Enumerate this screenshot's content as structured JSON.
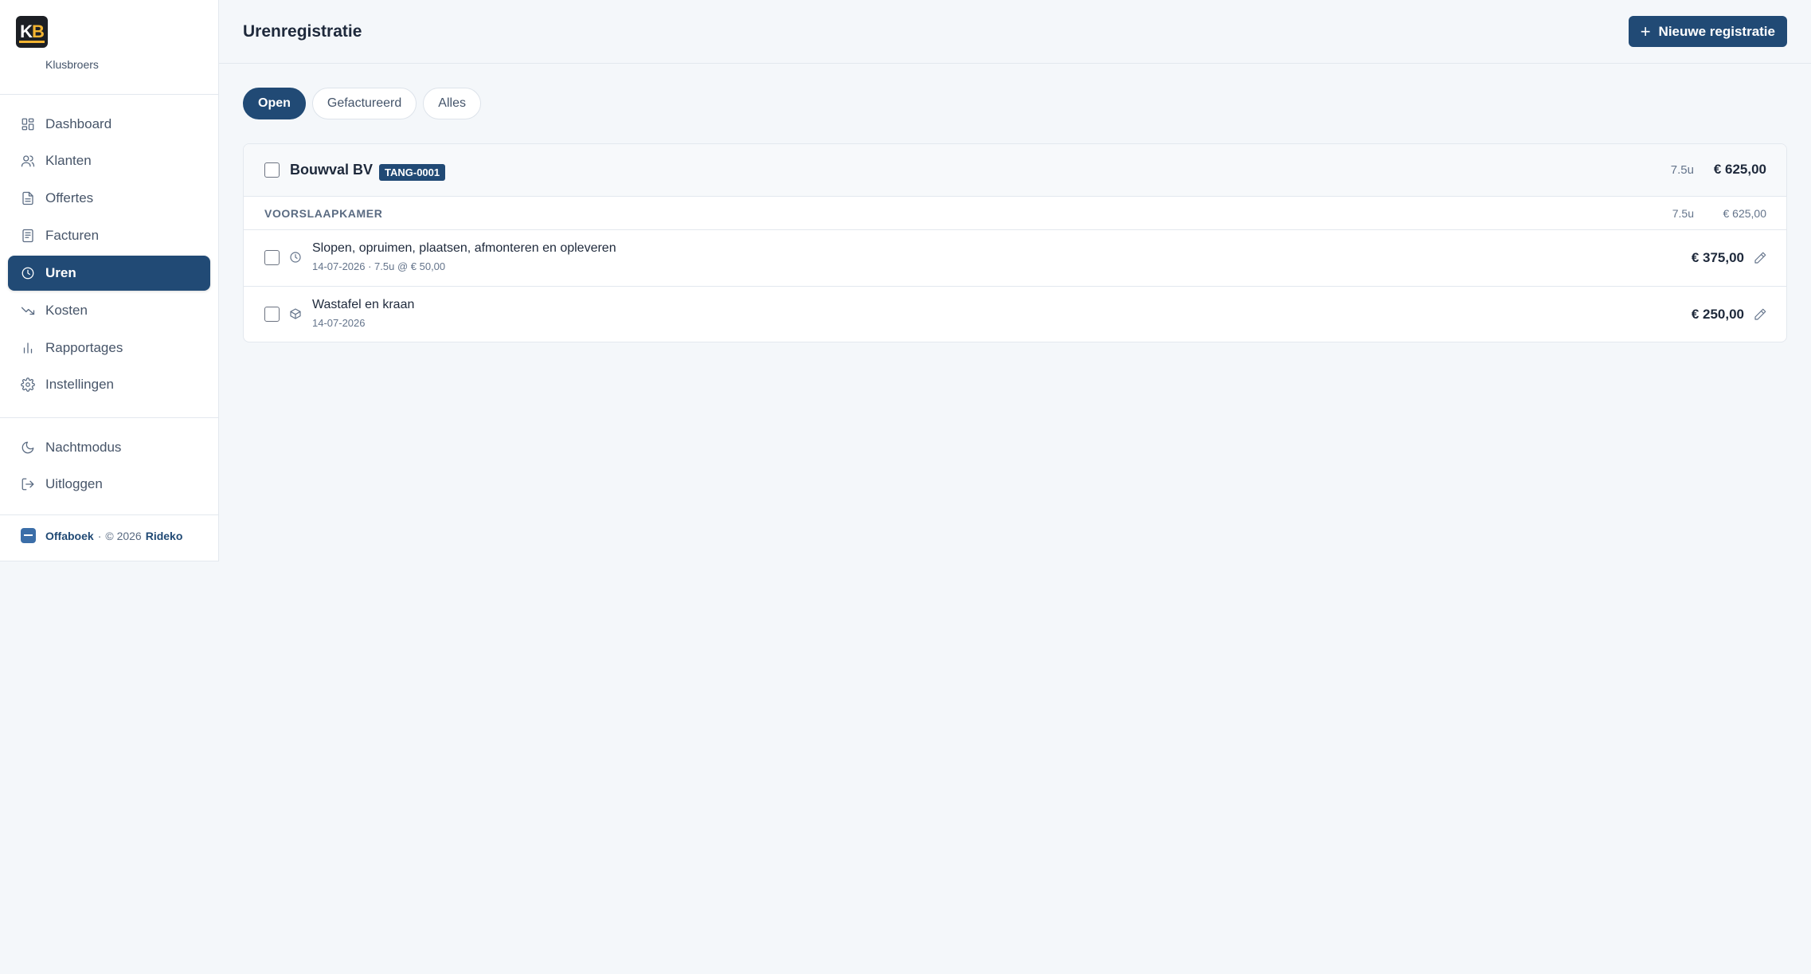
{
  "sidebar": {
    "logo_k": "K",
    "logo_b": "B",
    "company": "Klusbroers",
    "nav": [
      {
        "label": "Dashboard",
        "icon": "dashboard-icon"
      },
      {
        "label": "Klanten",
        "icon": "users-icon"
      },
      {
        "label": "Offertes",
        "icon": "document-icon"
      },
      {
        "label": "Facturen",
        "icon": "invoice-icon"
      },
      {
        "label": "Uren",
        "icon": "clock-icon",
        "active": true
      },
      {
        "label": "Kosten",
        "icon": "trending-down-icon"
      },
      {
        "label": "Rapportages",
        "icon": "bar-chart-icon"
      },
      {
        "label": "Instellingen",
        "icon": "gear-icon"
      }
    ],
    "secondary": [
      {
        "label": "Nachtmodus",
        "icon": "moon-icon"
      },
      {
        "label": "Uitloggen",
        "icon": "logout-icon"
      }
    ],
    "footer": {
      "brand": "Offaboek",
      "sep": "·",
      "copyright": "© 2026",
      "author": "Rideko"
    }
  },
  "header": {
    "title": "Urenregistratie",
    "new_button": "Nieuwe registratie"
  },
  "filters": [
    {
      "label": "Open",
      "active": true
    },
    {
      "label": "Gefactureerd",
      "active": false
    },
    {
      "label": "Alles",
      "active": false
    }
  ],
  "client_card": {
    "client_name": "Bouwval BV",
    "project_code": "TANG-0001",
    "total_hours": "7.5u",
    "total_amount": "€ 625,00",
    "group": {
      "label": "VOORSLAAPKAMER",
      "hours": "7.5u",
      "amount": "€ 625,00"
    },
    "entries": [
      {
        "type_icon": "clock-icon",
        "title": "Slopen, opruimen, plaatsen, afmonteren en opleveren",
        "subtitle": "14-07-2026 · 7.5u @ € 50,00",
        "amount": "€ 375,00"
      },
      {
        "type_icon": "package-icon",
        "title": "Wastafel en kraan",
        "subtitle": "14-07-2026",
        "amount": "€ 250,00"
      }
    ]
  },
  "colors": {
    "primary": "#214a75",
    "background": "#f4f7fa",
    "logo_accent": "#f3b431"
  }
}
